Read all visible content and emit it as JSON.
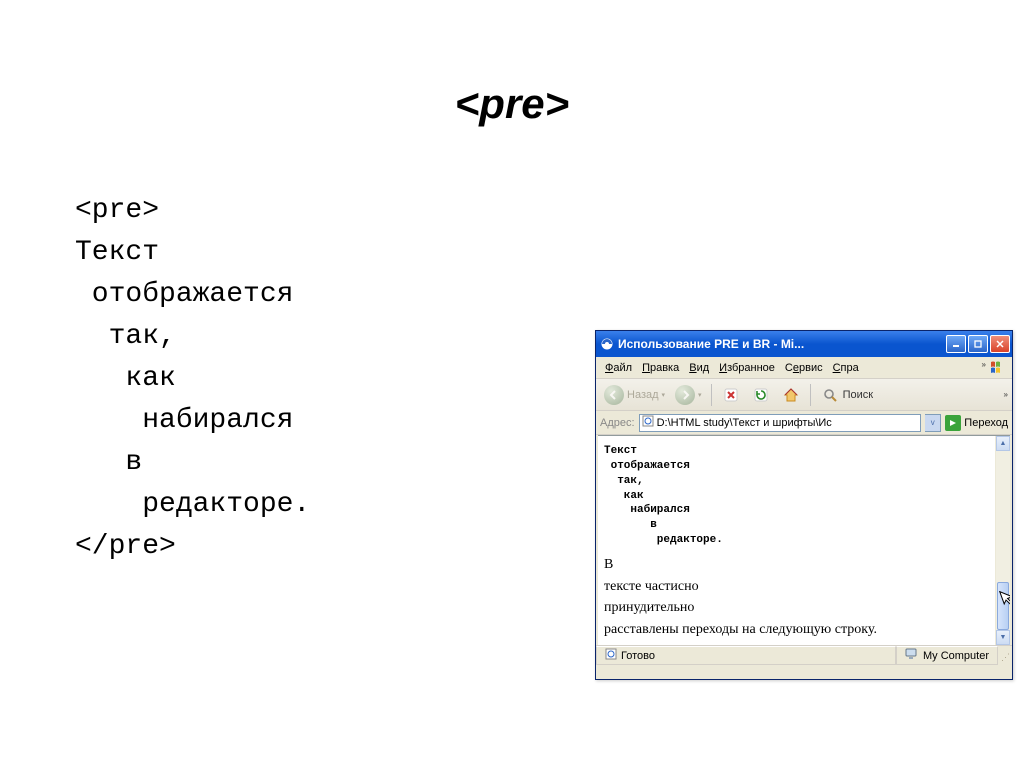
{
  "title": "<pre>",
  "code": "<pre>\nТекст\n отображается\n  так,\n   как\n    набирался\n   в\n    редакторе.\n</pre>",
  "browser": {
    "window_title": "Использование PRE и BR - Mi...",
    "menu": {
      "file": "Файл",
      "edit": "Правка",
      "view": "Вид",
      "favorites": "Избранное",
      "tools": "Сервис",
      "help": "Спра"
    },
    "toolbar": {
      "back_label": "Назад",
      "search_label": "Поиск"
    },
    "addressbar": {
      "label": "Адрес:",
      "path": "D:\\HTML study\\Текст  и шрифты\\Ис",
      "go_label": "Переход"
    },
    "page": {
      "pre_text": "Текст\n отображается\n  так,\n   как\n    набирался\n       в\n        редакторе.",
      "paragraphs": [
        "В",
        "тексте частисно",
        "принудительно",
        "расставлены переходы на следующую строку."
      ]
    },
    "statusbar": {
      "left": "Готово",
      "right": "My Computer"
    }
  }
}
